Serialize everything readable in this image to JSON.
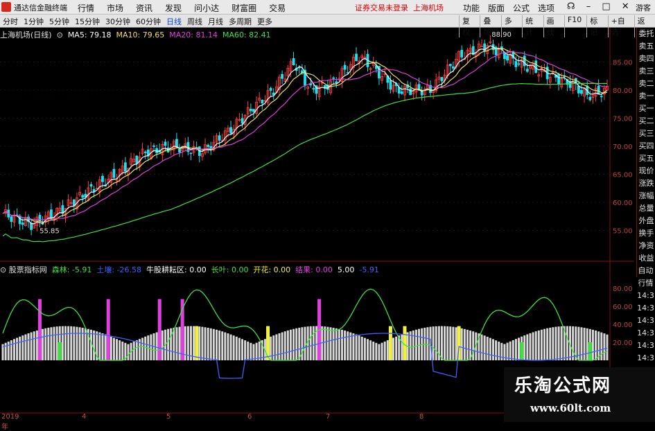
{
  "menubar": {
    "app_title": "通达信金融终端",
    "menus": [
      "行情",
      "市场",
      "资讯",
      "发现",
      "问小达",
      "财富圈",
      "交易"
    ],
    "trade_notice": "证券交易未登录",
    "trade_stock": "上海机场",
    "right_items": [
      "功能",
      "版面",
      "公式",
      "选项"
    ],
    "guest": "游客"
  },
  "toolbar": {
    "periods": [
      "分时",
      "1分钟",
      "5分钟",
      "15分钟",
      "30分钟",
      "60分钟",
      "日线",
      "周线",
      "月线",
      "多周期",
      "更多"
    ],
    "active_period": "日线",
    "tools": [
      "复权",
      "叠加",
      "多股",
      "统计",
      "画线",
      "F10",
      "标记",
      "+自选",
      "返回"
    ]
  },
  "main_chart": {
    "title": "上海机场(日线)",
    "ma5": "MA5: 79.18",
    "ma10": "MA10: 79.65",
    "ma20": "MA20: 81.14",
    "ma60": "MA60: 82.41",
    "high_label": "88.90",
    "low_label": "55.85",
    "y_ticks": [
      "85.00",
      "80.00",
      "75.00",
      "70.00",
      "65.00",
      "60.00",
      "55.00"
    ],
    "colors": {
      "up": "#ff4040",
      "down": "#20e0f0",
      "ma5": "#ffffff",
      "ma10": "#f0e060",
      "ma20": "#e040e0",
      "ma60": "#40e040"
    }
  },
  "indicator": {
    "name": "股票指标网",
    "items": [
      {
        "label": "森林: -5.91",
        "color": "#ffffff"
      },
      {
        "label": "土壤: -26.58",
        "color": "#4060ff"
      },
      {
        "label": "牛股耕耘区: 0.00",
        "color": "#ffffff"
      },
      {
        "label": "长叶: 0.00",
        "color": "#40e040"
      },
      {
        "label": "开花: 0.00",
        "color": "#f0f040"
      },
      {
        "label": "结果: 0.00",
        "color": "#e040e0"
      },
      {
        "label": "5.00",
        "color": "#ffffff"
      },
      {
        "label": "-5.91",
        "color": "#4060ff"
      }
    ],
    "y_ticks": [
      "80.00",
      "60.00",
      "40.00",
      "20.00"
    ]
  },
  "side_panel": [
    "委托",
    "卖五",
    "卖四",
    "卖三",
    "卖二",
    "卖一",
    "买一",
    "买二",
    "买三",
    "买四",
    "买五",
    "现价",
    "涨跌",
    "涨幅",
    "总量",
    "外盘",
    "换手",
    "净资",
    "收益"
  ],
  "side_panel2": [
    "自动",
    "行情",
    "14:3",
    "14:3",
    "14:3",
    "14:3",
    "14:3",
    "14:3",
    "14:3"
  ],
  "dates": [
    "2019年",
    "4",
    "5",
    "6",
    "7",
    "8"
  ],
  "watermark": {
    "title": "乐淘公式网",
    "url": "www.60lt.com"
  }
}
